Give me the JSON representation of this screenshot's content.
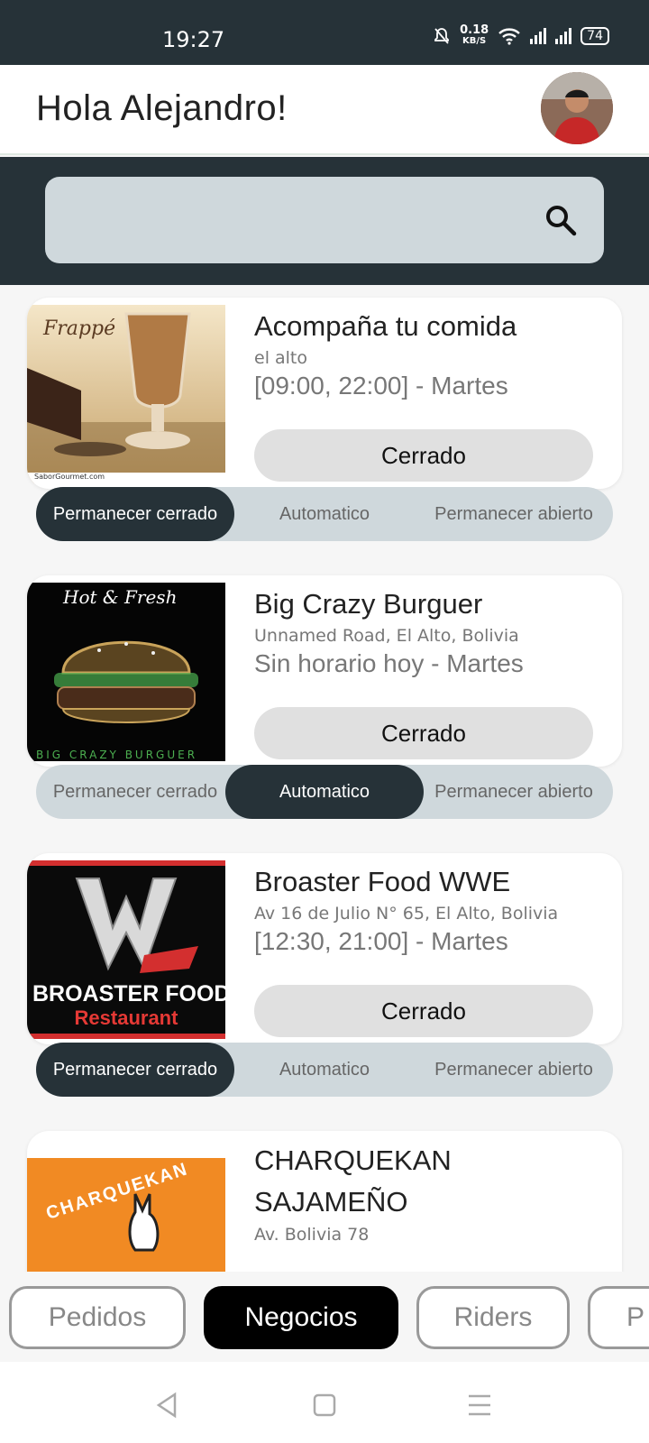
{
  "status_bar": {
    "time": "19:27",
    "net_speed_value": "0.18",
    "net_speed_unit": "KB/S",
    "battery": "74"
  },
  "header": {
    "greeting": "Hola Alejandro!"
  },
  "search": {
    "placeholder": ""
  },
  "businesses": [
    {
      "name": "Acompaña tu comida",
      "address": "el alto",
      "hours": "[09:00, 22:00] - Martes",
      "status": "Cerrado",
      "thumb_text": "Frappé",
      "thumb_caption": "SaborGourmet.com",
      "mode": "cerrado"
    },
    {
      "name": "Big Crazy Burguer",
      "address": "Unnamed Road, El Alto, Bolivia",
      "hours": "Sin horario hoy - Martes",
      "status": "Cerrado",
      "thumb_text": "Hot & Fresh",
      "thumb_caption": "BIG CRAZY BURGUER",
      "mode": "automatico"
    },
    {
      "name": "Broaster Food WWE",
      "address": "Av 16 de Julio N° 65, El Alto, Bolivia",
      "hours": "[12:30, 21:00] - Martes",
      "status": "Cerrado",
      "thumb_text": "BROASTER FOOD",
      "thumb_caption": "Restaurant",
      "mode": "cerrado"
    },
    {
      "name": "CHARQUEKAN SAJAMEÑO",
      "address": "Av. Bolivia 78",
      "thumb_text": "CHARQUEKAN"
    }
  ],
  "toggle_labels": {
    "closed": "Permanecer cerrado",
    "auto": "Automatico",
    "open": "Permanecer abierto"
  },
  "tabs": [
    {
      "label": "Pedidos",
      "active": false
    },
    {
      "label": "Negocios",
      "active": true
    },
    {
      "label": "Riders",
      "active": false
    },
    {
      "label": "P",
      "active": false
    }
  ],
  "colors": {
    "dark": "#263238",
    "search_bg": "#cfd8dc",
    "pill_bg": "#e0e0e0"
  }
}
